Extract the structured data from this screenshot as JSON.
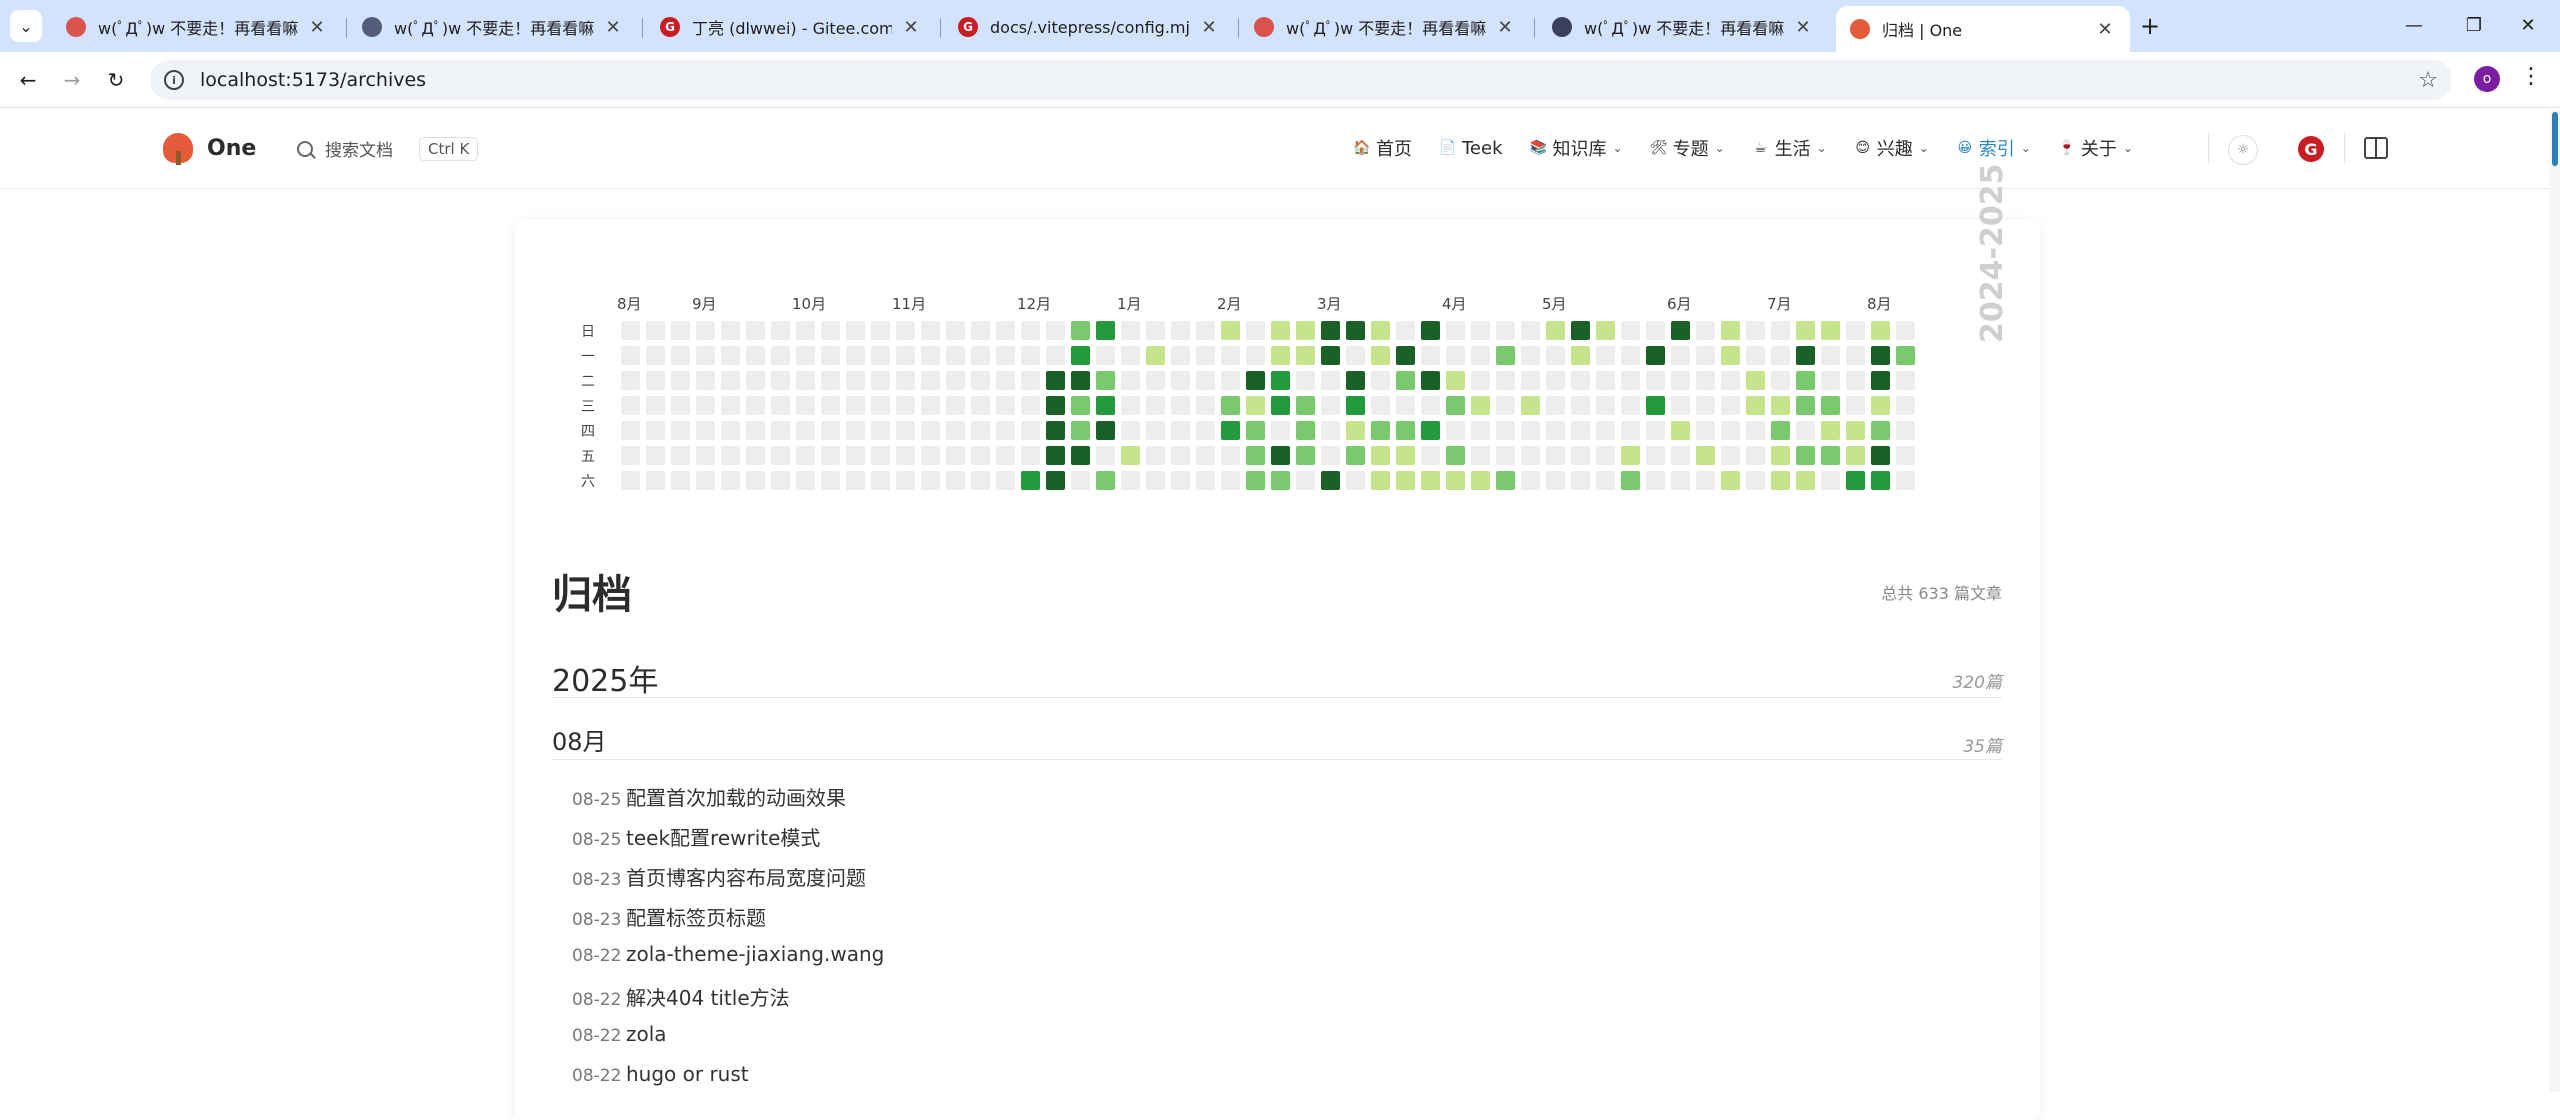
{
  "browser": {
    "tabs": [
      {
        "title": "w(ﾟДﾟ)w 不要走！再看看嘛！",
        "favicon_color": "#d9534f",
        "favicon_char": ""
      },
      {
        "title": "w(ﾟДﾟ)w 不要走！再看看嘛！",
        "favicon_color": "#555c7a",
        "favicon_char": ""
      },
      {
        "title": "丁亮 (dlwwei) - Gitee.com",
        "favicon_color": "#c71d23",
        "favicon_char": "G"
      },
      {
        "title": "docs/.vitepress/config.mjs · ",
        "favicon_color": "#c71d23",
        "favicon_char": "G"
      },
      {
        "title": "w(ﾟДﾟ)w 不要走！再看看嘛！",
        "favicon_color": "#d9534f",
        "favicon_char": ""
      },
      {
        "title": "w(ﾟДﾟ)w 不要走！再看看嘛！",
        "favicon_color": "#3a3f5c",
        "favicon_char": ""
      },
      {
        "title": "归档 | One",
        "favicon_color": "#e55b3c",
        "favicon_char": ""
      }
    ],
    "url": "localhost:5173/archives",
    "profile_initial": "o"
  },
  "site": {
    "name": "One",
    "search_label": "搜索文档",
    "search_shortcut": "Ctrl K",
    "menu": [
      {
        "label": "首页",
        "icon": "home-icon",
        "glyph": "🏠",
        "has_dropdown": false,
        "active": false
      },
      {
        "label": "Teek",
        "icon": "doc-icon",
        "glyph": "📄",
        "has_dropdown": false,
        "active": false
      },
      {
        "label": "知识库",
        "icon": "book-icon",
        "glyph": "📚",
        "has_dropdown": true,
        "active": false
      },
      {
        "label": "专题",
        "icon": "tools-icon",
        "glyph": "🛠",
        "has_dropdown": true,
        "active": false
      },
      {
        "label": "生活",
        "icon": "cafe-icon",
        "glyph": "☕",
        "has_dropdown": true,
        "active": false
      },
      {
        "label": "兴趣",
        "icon": "smile-icon",
        "glyph": "😊",
        "has_dropdown": true,
        "active": false
      },
      {
        "label": "索引",
        "icon": "face-icon",
        "glyph": "😀",
        "has_dropdown": true,
        "active": true
      },
      {
        "label": "关于",
        "icon": "wine-icon",
        "glyph": "🍷",
        "has_dropdown": true,
        "active": false
      }
    ]
  },
  "heatmap": {
    "months": [
      {
        "label": "8月",
        "week": 0
      },
      {
        "label": "9月",
        "week": 3
      },
      {
        "label": "10月",
        "week": 7
      },
      {
        "label": "11月",
        "week": 11
      },
      {
        "label": "12月",
        "week": 16
      },
      {
        "label": "1月",
        "week": 20
      },
      {
        "label": "2月",
        "week": 24
      },
      {
        "label": "3月",
        "week": 28
      },
      {
        "label": "4月",
        "week": 33
      },
      {
        "label": "5月",
        "week": 37
      },
      {
        "label": "6月",
        "week": 42
      },
      {
        "label": "7月",
        "week": 46
      },
      {
        "label": "8月",
        "week": 50
      }
    ],
    "weekdays": [
      "日",
      "一",
      "二",
      "三",
      "四",
      "五",
      "六"
    ],
    "year_label": "2024-2025",
    "colors": [
      "#ededf0",
      "#c6e48b",
      "#7bc96f",
      "#239a3b",
      "#196127"
    ],
    "levels": [
      [
        0,
        0,
        0,
        0,
        0,
        0,
        0
      ],
      [
        0,
        0,
        0,
        0,
        0,
        0,
        0
      ],
      [
        0,
        0,
        0,
        0,
        0,
        0,
        0
      ],
      [
        0,
        0,
        0,
        0,
        0,
        0,
        0
      ],
      [
        0,
        0,
        0,
        0,
        0,
        0,
        0
      ],
      [
        0,
        0,
        0,
        0,
        0,
        0,
        0
      ],
      [
        0,
        0,
        0,
        0,
        0,
        0,
        0
      ],
      [
        0,
        0,
        0,
        0,
        0,
        0,
        0
      ],
      [
        0,
        0,
        0,
        0,
        0,
        0,
        0
      ],
      [
        0,
        0,
        0,
        0,
        0,
        0,
        0
      ],
      [
        0,
        0,
        0,
        0,
        0,
        0,
        0
      ],
      [
        0,
        0,
        0,
        0,
        0,
        0,
        0
      ],
      [
        0,
        0,
        0,
        0,
        0,
        0,
        0
      ],
      [
        0,
        0,
        0,
        0,
        0,
        0,
        0
      ],
      [
        0,
        0,
        0,
        0,
        0,
        0,
        0
      ],
      [
        0,
        0,
        0,
        0,
        0,
        0,
        0
      ],
      [
        0,
        0,
        0,
        0,
        0,
        0,
        3
      ],
      [
        0,
        0,
        4,
        4,
        4,
        4,
        4
      ],
      [
        2,
        3,
        4,
        2,
        2,
        4,
        0
      ],
      [
        3,
        0,
        2,
        3,
        4,
        0,
        2
      ],
      [
        0,
        0,
        0,
        0,
        0,
        1,
        0
      ],
      [
        0,
        1,
        0,
        0,
        0,
        0,
        0
      ],
      [
        0,
        0,
        0,
        0,
        0,
        0,
        0
      ],
      [
        0,
        0,
        0,
        0,
        0,
        0,
        0
      ],
      [
        1,
        0,
        0,
        2,
        3,
        0,
        0
      ],
      [
        0,
        0,
        4,
        1,
        2,
        2,
        2
      ],
      [
        1,
        1,
        3,
        3,
        0,
        4,
        2
      ],
      [
        1,
        1,
        0,
        2,
        2,
        2,
        0
      ],
      [
        4,
        4,
        0,
        0,
        0,
        0,
        4
      ],
      [
        4,
        0,
        4,
        3,
        1,
        2,
        0
      ],
      [
        1,
        1,
        0,
        0,
        2,
        1,
        1
      ],
      [
        0,
        4,
        2,
        0,
        2,
        1,
        1
      ],
      [
        4,
        0,
        4,
        0,
        3,
        0,
        1
      ],
      [
        0,
        0,
        1,
        2,
        0,
        2,
        1
      ],
      [
        0,
        0,
        0,
        1,
        0,
        0,
        1
      ],
      [
        0,
        2,
        0,
        0,
        0,
        0,
        2
      ],
      [
        0,
        0,
        0,
        1,
        0,
        0,
        0
      ],
      [
        1,
        0,
        0,
        0,
        0,
        0,
        0
      ],
      [
        4,
        1,
        0,
        0,
        0,
        0,
        0
      ],
      [
        1,
        0,
        0,
        0,
        0,
        0,
        0
      ],
      [
        0,
        0,
        0,
        0,
        0,
        1,
        2
      ],
      [
        0,
        4,
        0,
        3,
        0,
        0,
        0
      ],
      [
        4,
        0,
        0,
        0,
        1,
        0,
        0
      ],
      [
        0,
        0,
        0,
        0,
        0,
        1,
        0
      ],
      [
        1,
        1,
        0,
        0,
        0,
        0,
        1
      ],
      [
        0,
        0,
        1,
        1,
        0,
        0,
        0
      ],
      [
        0,
        0,
        0,
        1,
        2,
        1,
        1
      ],
      [
        1,
        4,
        2,
        2,
        0,
        2,
        1
      ],
      [
        1,
        0,
        0,
        2,
        1,
        2,
        0
      ],
      [
        0,
        0,
        0,
        0,
        1,
        1,
        3
      ],
      [
        1,
        4,
        4,
        1,
        2,
        4,
        3
      ],
      [
        0,
        2,
        0,
        0,
        0,
        0,
        0
      ]
    ]
  },
  "archive": {
    "title": "归档",
    "total": "总共 633 篇文章",
    "year": "2025年",
    "year_count": "320篇",
    "month": "08月",
    "month_count": "35篇",
    "posts": [
      {
        "date": "08-25",
        "title": "配置首次加载的动画效果"
      },
      {
        "date": "08-25",
        "title": "teek配置rewrite模式"
      },
      {
        "date": "08-23",
        "title": "首页博客内容布局宽度问题"
      },
      {
        "date": "08-23",
        "title": "配置标签页标题"
      },
      {
        "date": "08-22",
        "title": "zola-theme-jiaxiang.wang"
      },
      {
        "date": "08-22",
        "title": "解决404 title方法"
      },
      {
        "date": "08-22",
        "title": "zola"
      },
      {
        "date": "08-22",
        "title": "hugo or rust"
      }
    ]
  }
}
